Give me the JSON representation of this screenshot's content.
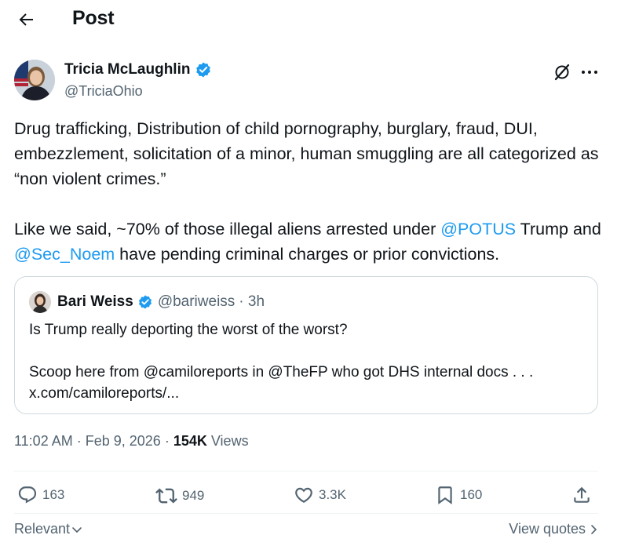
{
  "header": {
    "title": "Post"
  },
  "author": {
    "name": "Tricia McLaughlin",
    "handle": "@TriciaOhio",
    "verified": true
  },
  "tweet": {
    "para1": "Drug trafficking, Distribution of child pornography, burglary, fraud, DUI, embezzlement, solicitation of a minor, human smuggling are all categorized as “non violent crimes.”",
    "para2_a": "Like we said, ~70% of those illegal aliens arrested under ",
    "mention1": "@POTUS",
    "para2_b": " Trump and ",
    "mention2": "@Sec_Noem",
    "para2_c": " have pending criminal charges or prior convictions."
  },
  "quote": {
    "name": "Bari Weiss",
    "handle": "@bariweiss",
    "time": "· 3h",
    "line1": "Is Trump really deporting the worst of the worst?",
    "line2": "Scoop here from @camiloreports in @TheFP  who got DHS internal docs . . .",
    "line3": "x.com/camiloreports/..."
  },
  "meta": {
    "time": "11:02 AM",
    "date": "Feb 9, 2026",
    "views_count": "154K",
    "views_label": "Views"
  },
  "actions": {
    "replies": "163",
    "reposts": "949",
    "likes": "3.3K",
    "bookmarks": "160"
  },
  "footer": {
    "sort_label": "Relevant",
    "view_quotes": "View quotes"
  },
  "colors": {
    "accent": "#1d9bf0",
    "secondary_text": "#536471",
    "primary_text": "#0f1419",
    "border": "#cfd9de"
  }
}
